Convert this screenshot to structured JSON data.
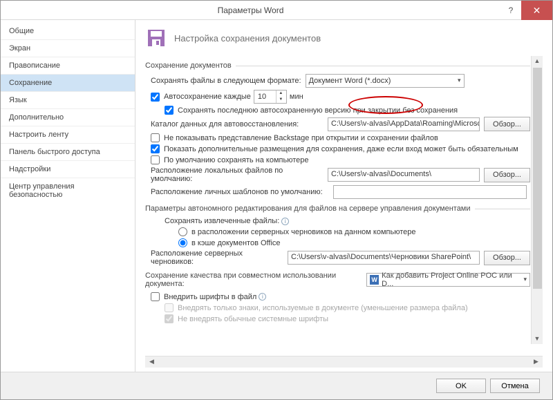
{
  "title": "Параметры Word",
  "sidebar": {
    "items": [
      {
        "label": "Общие"
      },
      {
        "label": "Экран"
      },
      {
        "label": "Правописание"
      },
      {
        "label": "Сохранение"
      },
      {
        "label": "Язык"
      },
      {
        "label": "Дополнительно"
      },
      {
        "label": "Настроить ленту"
      },
      {
        "label": "Панель быстрого доступа"
      },
      {
        "label": "Надстройки"
      },
      {
        "label": "Центр управления безопасностью"
      }
    ],
    "selected_index": 3
  },
  "header": {
    "label": "Настройка сохранения документов"
  },
  "sec_save": {
    "title": "Сохранение документов",
    "format_label": "Сохранять файлы в следующем формате:",
    "format_value": "Документ Word (*.docx)",
    "autosave_label": "Автосохранение каждые",
    "autosave_value": "10",
    "autosave_unit": "мин",
    "keep_last": "Сохранять последнюю автосохраненную версию при закрытии без сохранения",
    "recover_label": "Каталог данных для автовосстановления:",
    "recover_path": "C:\\Users\\v-alvasi\\AppData\\Roaming\\Microsoft\\Word",
    "browse": "Обзор...",
    "no_backstage": "Не показывать представление Backstage при открытии и сохранении файлов",
    "show_addl": "Показать дополнительные размещения для сохранения, даже если вход может быть обязательным",
    "default_pc": "По умолчанию сохранять на компьютере",
    "local_default_label": "Расположение локальных файлов по умолчанию:",
    "local_default_path": "C:\\Users\\v-alvasi\\Documents\\",
    "templates_label": "Расположение личных шаблонов по умолчанию:",
    "templates_path": ""
  },
  "sec_offline": {
    "title": "Параметры автономного редактирования для файлов на сервере управления документами",
    "save_to_label": "Сохранять извлеченные файлы:",
    "opt_server": "в расположении серверных черновиков на данном компьютере",
    "opt_cache": "в кэше документов Office",
    "drafts_label": "Расположение серверных черновиков:",
    "drafts_path": "C:\\Users\\v-alvasi\\Documents\\Черновики SharePoint\\"
  },
  "sec_quality": {
    "title": "Сохранение качества при совместном использовании документа:",
    "doc_value": "Как добавить Project Online POC или D...",
    "embed": "Внедрить шрифты в файл",
    "embed_used": "Внедрять только знаки, используемые в документе (уменьшение размера файла)",
    "embed_sys": "Не внедрять обычные системные шрифты"
  },
  "footer": {
    "ok": "OK",
    "cancel": "Отмена"
  }
}
